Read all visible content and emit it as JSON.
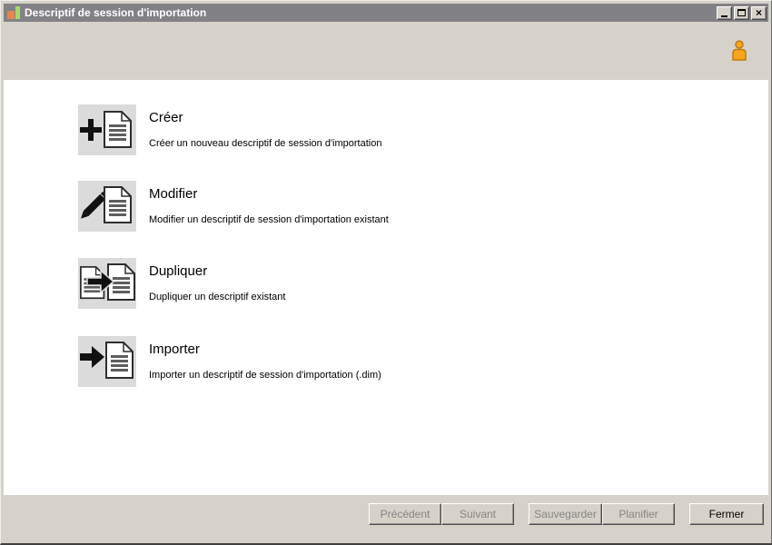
{
  "window": {
    "title": "Descriptif de session d'importation",
    "icon": "bar-chart-window-icon",
    "controls": {
      "minimize": "minimize-icon",
      "maximize": "maximize-icon",
      "close": "close-icon"
    }
  },
  "header": {
    "icon": "person-icon"
  },
  "actions": [
    {
      "title": "Créer",
      "description": "Créer un nouveau descriptif de session d'importation",
      "icon": "plus-document-icon"
    },
    {
      "title": "Modifier",
      "description": "Modifier un descriptif de session d'importation existant",
      "icon": "pencil-document-icon"
    },
    {
      "title": "Dupliquer",
      "description": "Dupliquer un descriptif existant",
      "icon": "duplicate-document-icon"
    },
    {
      "title": "Importer",
      "description": "Importer un descriptif de session d'importation (.dim)",
      "icon": "import-arrow-document-icon"
    }
  ],
  "footer": {
    "buttons": [
      {
        "label": "Précédent",
        "enabled": false
      },
      {
        "label": "Suivant",
        "enabled": false
      },
      {
        "label": "Sauvegarder",
        "enabled": false
      },
      {
        "label": "Planifier",
        "enabled": false
      },
      {
        "label": "Fermer",
        "enabled": true
      }
    ]
  },
  "colors": {
    "titlebar": "#828286",
    "chrome": "#D6D2CA",
    "content_bg": "#FFFFFF",
    "icon_tile_bg": "#DBDBDB",
    "accent_orange": "#F5A61E",
    "window_icon_orange": "#E8854F",
    "window_icon_green": "#A6D96A",
    "disabled_text": "#858585"
  }
}
